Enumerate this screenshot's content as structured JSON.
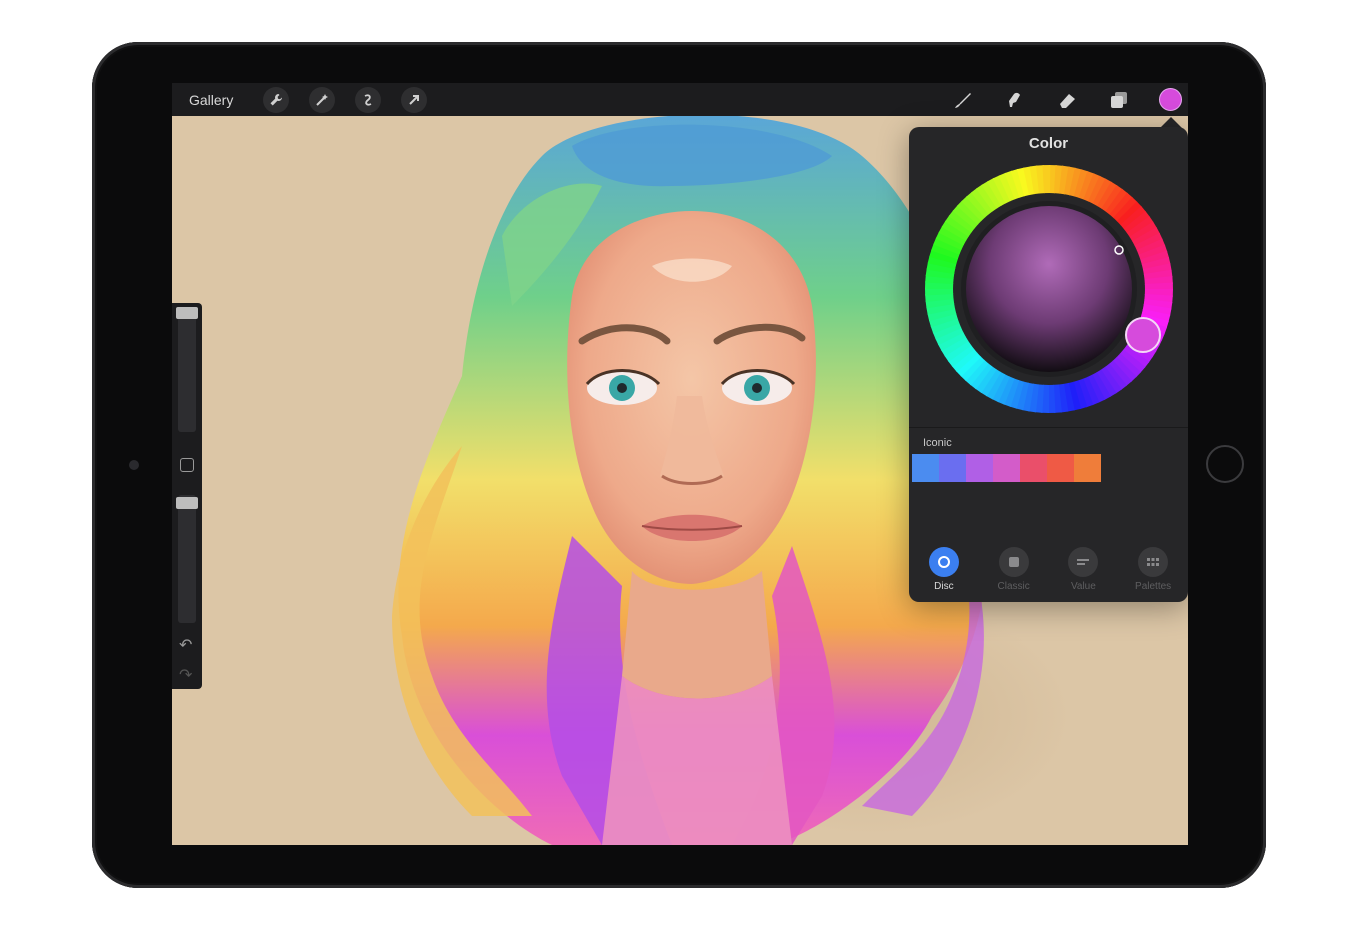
{
  "toolbar": {
    "gallery_label": "Gallery",
    "left_tools": [
      "wrench-icon",
      "magic-wand-icon",
      "selection-icon",
      "transform-arrow-icon"
    ],
    "right_tools": [
      "brush-icon",
      "smudge-icon",
      "eraser-icon",
      "layers-icon"
    ],
    "current_color": "#d64bdc"
  },
  "color_panel": {
    "title": "Color",
    "palette_name": "Iconic",
    "palette_swatches": [
      "#4b8cf0",
      "#6a6ef0",
      "#b05fe6",
      "#d35cc9",
      "#ea4f6a",
      "#ef5a45",
      "#ef7d3a"
    ],
    "selected_color": "#d64bdc",
    "tabs": [
      {
        "label": "Disc",
        "icon": "disc-icon",
        "active": true
      },
      {
        "label": "Classic",
        "icon": "classic-icon",
        "active": false
      },
      {
        "label": "Value",
        "icon": "value-icon",
        "active": false
      },
      {
        "label": "Palettes",
        "icon": "palettes-icon",
        "active": false
      }
    ]
  },
  "sidebar": {
    "controls": [
      "brush-size-slider",
      "modify-button",
      "opacity-slider",
      "undo-icon",
      "redo-icon"
    ]
  },
  "canvas": {
    "background_color": "#dcc6a6",
    "subject": "colorful portrait painting"
  }
}
